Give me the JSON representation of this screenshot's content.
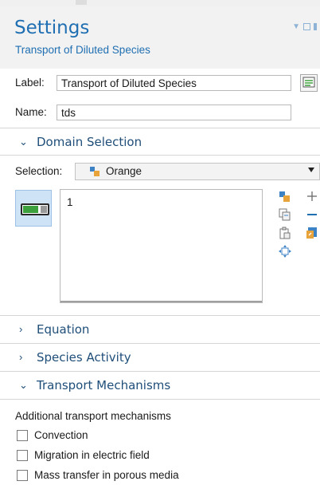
{
  "header": {
    "title": "Settings",
    "subtitle": "Transport of Diluted Species"
  },
  "form": {
    "label_caption": "Label:",
    "label_value": "Transport of Diluted Species",
    "name_caption": "Name:",
    "name_value": "tds"
  },
  "domain_selection": {
    "heading": "Domain Selection",
    "selection_caption": "Selection:",
    "selection_value": "Orange",
    "items": [
      "1"
    ]
  },
  "sections": {
    "equation": "Equation",
    "species_activity": "Species Activity",
    "transport_mechanisms": "Transport Mechanisms"
  },
  "transport": {
    "caption": "Additional transport mechanisms",
    "options": [
      {
        "label": "Convection",
        "checked": false
      },
      {
        "label": "Migration in electric field",
        "checked": false
      },
      {
        "label": "Mass transfer in porous media",
        "checked": false
      }
    ]
  },
  "colors": {
    "accent": "#1f6fb2",
    "section_text": "#1f4e79",
    "header_bg": "#f2f2f2",
    "toggle_bg": "#cfe3f6",
    "toggle_fill": "#3ca13c"
  },
  "icons": {
    "window_controls": [
      "dropdown-arrow-icon",
      "restore-icon",
      "pin-icon"
    ],
    "label_field_action": "form-text-icon",
    "combo": "selection-paint-icon",
    "side_tools": [
      "paste-selection-icon",
      "copy-selection-icon",
      "clipboard-icon",
      "zoom-to-selection-icon",
      "add-icon",
      "remove-icon",
      "clear-selection-icon"
    ]
  }
}
